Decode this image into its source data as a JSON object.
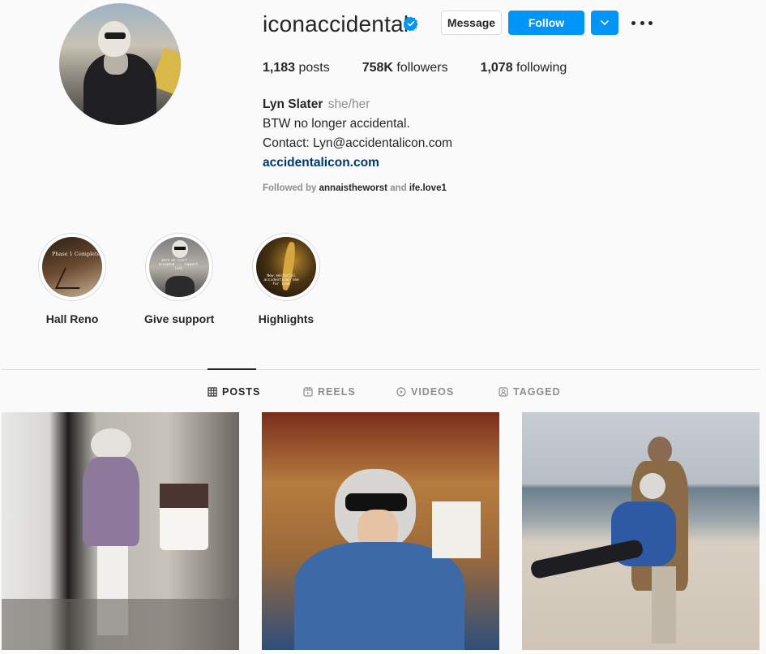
{
  "profile": {
    "username": "iconaccidental",
    "verified": true,
    "buttons": {
      "message": "Message",
      "follow": "Follow"
    },
    "stats": {
      "posts_count": "1,183",
      "posts_label": " posts",
      "followers_count": "758K",
      "followers_label": " followers",
      "following_count": "1,078",
      "following_label": " following"
    },
    "full_name": "Lyn Slater",
    "pronouns": "she/her",
    "bio_line1": "BTW no longer accidental.",
    "bio_line2": "Contact: Lyn@accidentalicon.com",
    "website": "accidentalicon.com",
    "followed_by_prefix": "Followed by ",
    "followed_by_user1": "annaistheworst",
    "followed_by_and": " and ",
    "followed_by_user2": "ife.love1"
  },
  "highlights": [
    {
      "label": "Hall Reno",
      "cover_text": "Phase 1 Complete"
    },
    {
      "label": "Give support",
      "cover_text": "more on scarf ... accepted ... support link"
    },
    {
      "label": "Highlights",
      "cover_text": "New editorial accidentical see for link"
    }
  ],
  "tabs": [
    {
      "label": "POSTS",
      "icon": "grid-icon",
      "active": true
    },
    {
      "label": "REELS",
      "icon": "reels-icon",
      "active": false
    },
    {
      "label": "VIDEOS",
      "icon": "play-icon",
      "active": false
    },
    {
      "label": "TAGGED",
      "icon": "tag-icon",
      "active": false
    }
  ],
  "posts": [
    {
      "description": "mirror-selfie"
    },
    {
      "description": "denim-portrait"
    },
    {
      "description": "beach-couple"
    }
  ],
  "colors": {
    "accent": "#0095f6",
    "link": "#00376b",
    "muted": "#8e8e8e"
  }
}
